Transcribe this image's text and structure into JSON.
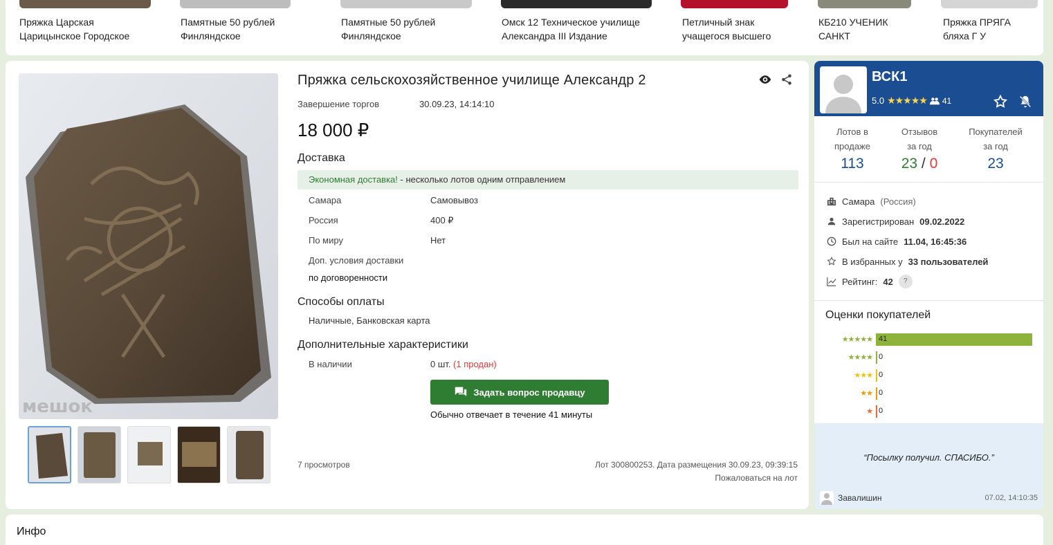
{
  "carousel": {
    "items": [
      {
        "line1": "Пряжка Царская",
        "line2": "Царицынское Городское"
      },
      {
        "line1": "Памятные 50 рублей",
        "line2": "Финляндское"
      },
      {
        "line1": "Памятные 50 рублей",
        "line2": "Финляндское"
      },
      {
        "line1": "Омск 12 Техническое училище",
        "line2": "Александра III Издание"
      },
      {
        "line1": "Петличный знак",
        "line2": "учащегося высшего"
      },
      {
        "line1": "КБ210 УЧЕНИК",
        "line2": "САНКТ"
      },
      {
        "line1": "Пряжка ПРЯГА",
        "line2": "бляха Г У"
      }
    ]
  },
  "lot": {
    "title": "Пряжка сельскохозяйственное училище Александр 2",
    "watermark": "мешок",
    "auction_end_label": "Завершение торгов",
    "auction_end_value": "30.09.23, 14:14:10",
    "price": "18 000 ₽",
    "delivery_heading": "Доставка",
    "economy_label": "Экономная доставка!",
    "economy_text": " - несколько лотов одним отправлением",
    "delivery": [
      {
        "place": "Самара",
        "value": "Самовывоз"
      },
      {
        "place": "Россия",
        "value": "400 ₽"
      },
      {
        "place": "По миру",
        "value": "Нет"
      }
    ],
    "extra_delivery_label": "Доп. условия доставки",
    "extra_delivery_value": "по договоренности",
    "payment_heading": "Способы оплаты",
    "payment_value": "Наличные, Банковская карта",
    "extra_heading": "Дополнительные характеристики",
    "stock_label": "В наличии",
    "stock_value": "0 шт.",
    "stock_sold": "(1 продан)",
    "ask_button": "Задать вопрос продавцу",
    "response_time": "Обычно отвечает в течение 41 минуты",
    "views": "7 просмотров",
    "lot_info": "Лот 300800253. Дата размещения 30.09.23, 09:39:15",
    "complain": "Пожаловаться на лот"
  },
  "seller": {
    "name": "ВСК1",
    "rating": "5.0",
    "reviews_count": "41",
    "stats": [
      {
        "label1": "Лотов в",
        "label2": "продаже",
        "value": "113"
      },
      {
        "label1": "Отзывов",
        "label2": "за год",
        "value_pos": "23",
        "value_sep": " / ",
        "value_neg": "0"
      },
      {
        "label1": "Покупателей",
        "label2": "за год",
        "value": "23"
      }
    ],
    "city": "Самара",
    "country": "(Россия)",
    "registered_label": "Зарегистрирован",
    "registered_value": "09.02.2022",
    "last_seen_label": "Был на сайте",
    "last_seen_value": "11.04, 16:45:36",
    "favorites_label": "В избранных у",
    "favorites_value": "33 пользователей",
    "rating_label": "Рейтинг:",
    "rating_value": "42",
    "rating_help": "?",
    "buyer_ratings_heading": "Оценки покупателей",
    "ratings": [
      {
        "stars": "★★★★★",
        "count": "41",
        "fraction": 1.0,
        "color": "#8db33a"
      },
      {
        "stars": "★★★★",
        "count": "0",
        "fraction": 0,
        "color": "#8db33a"
      },
      {
        "stars": "★★★",
        "count": "0",
        "fraction": 0,
        "color": "#f2c200"
      },
      {
        "stars": "★★",
        "count": "0",
        "fraction": 0,
        "color": "#f29b00"
      },
      {
        "stars": "★",
        "count": "0",
        "fraction": 0,
        "color": "#f26a2e"
      }
    ],
    "review_text": "“Посылку получил. СПАСИБО.”",
    "review_author": "Завалишин",
    "review_date": "07.02, 14:10:35"
  },
  "bottom": {
    "heading": "Инфо"
  },
  "colors": {
    "accent_green": "#2e7d32",
    "brand_blue": "#1a4d91",
    "link_blue": "#1a4d91",
    "negative_red": "#e53935"
  }
}
